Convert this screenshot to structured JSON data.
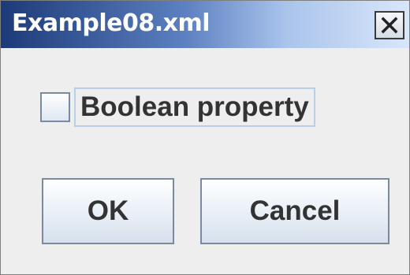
{
  "window": {
    "title": "Example08.xml",
    "close_icon": "close-icon"
  },
  "form": {
    "checkbox": {
      "label": "Boolean property",
      "checked": false
    }
  },
  "buttons": {
    "ok_label": "OK",
    "cancel_label": "Cancel"
  },
  "colors": {
    "titlebar_start": "#1c3a78",
    "titlebar_end": "#d8e6fa",
    "dialog_background": "#eeeeee",
    "text": "#333333"
  }
}
